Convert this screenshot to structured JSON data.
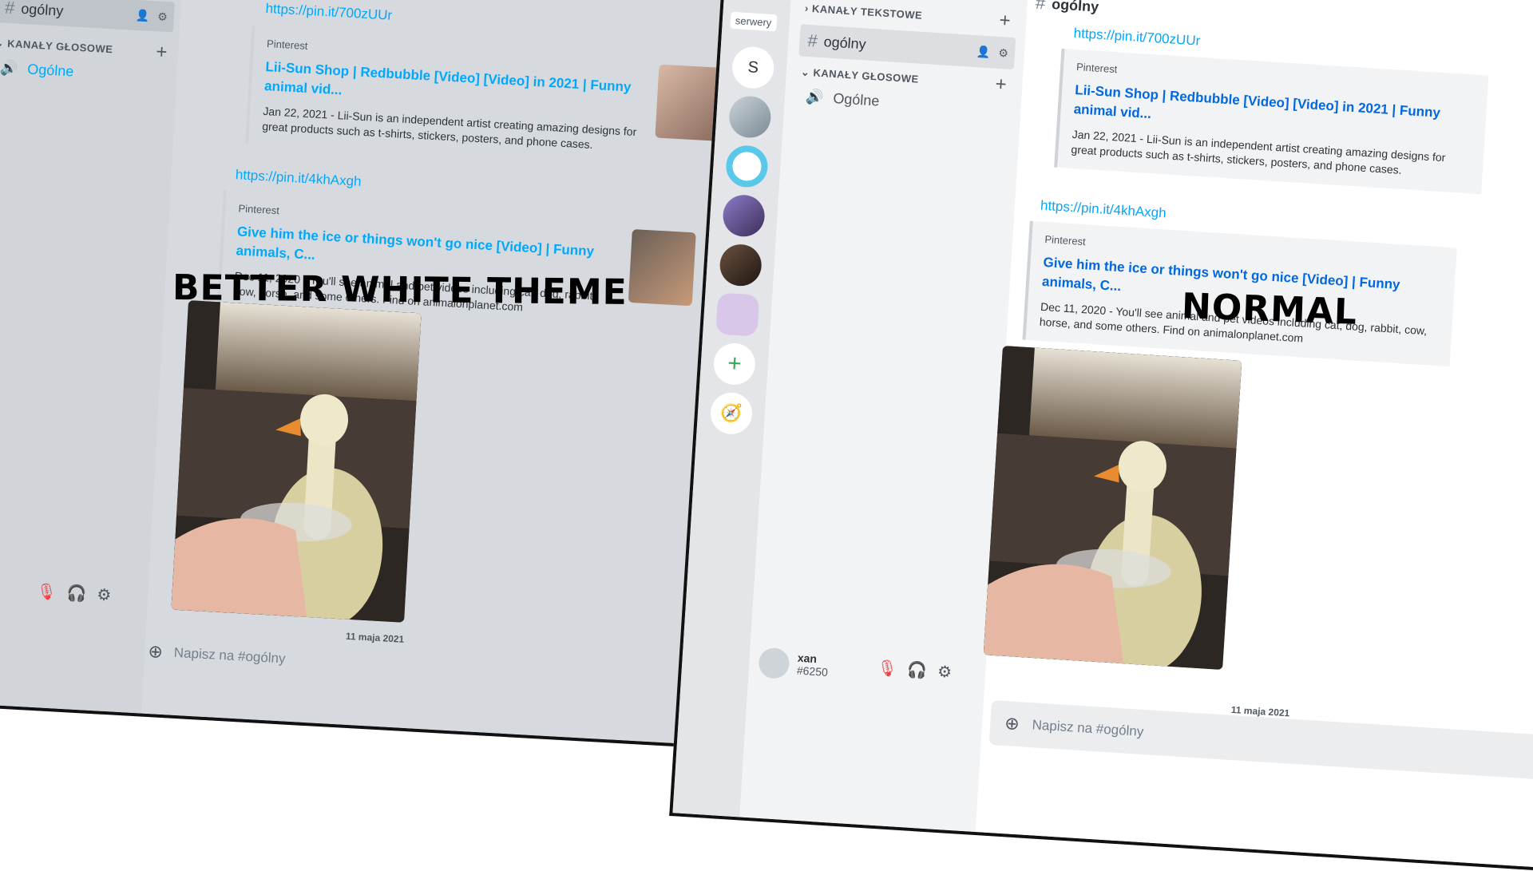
{
  "labels": {
    "left": "BETTER WHITE THEME",
    "right": "NORMAL"
  },
  "channel": {
    "active_name": "ogólny",
    "voice_category": "KANAŁY GŁOSOWE",
    "text_category": "KANAŁY TEKSTOWE",
    "voice_channel": "Ogólne"
  },
  "servers": {
    "tooltip": "serwery",
    "initial": "S"
  },
  "messages": {
    "link1": "https://pin.it/700zUUr",
    "embed1": {
      "provider": "Pinterest",
      "title": "Lii-Sun Shop | Redbubble [Video] [Video] in 2021 | Funny animal vid...",
      "desc": "Jan 22, 2021 - Lii-Sun is an independent artist creating amazing designs for great products such as t-shirts, stickers, posters, and phone cases."
    },
    "link2": "https://pin.it/4khAxgh",
    "embed2": {
      "provider": "Pinterest",
      "title": "Give him the ice or things won't go nice [Video] | Funny animals, C...",
      "desc": "Dec 11, 2020 - You'll see animal and pet videos including cat, dog, rabbit, cow, horse, and some others. Find on animalonplanet.com"
    }
  },
  "divider_date": "11 maja 2021",
  "composer_placeholder": "Napisz na #ogólny",
  "user": {
    "name": "xan",
    "tag": "#6250",
    "tag_left": "6250",
    "name_left": "an"
  },
  "colors": {
    "link": "#00a8fc",
    "accent": "#5865f2",
    "bg_left": "#d6dade"
  }
}
